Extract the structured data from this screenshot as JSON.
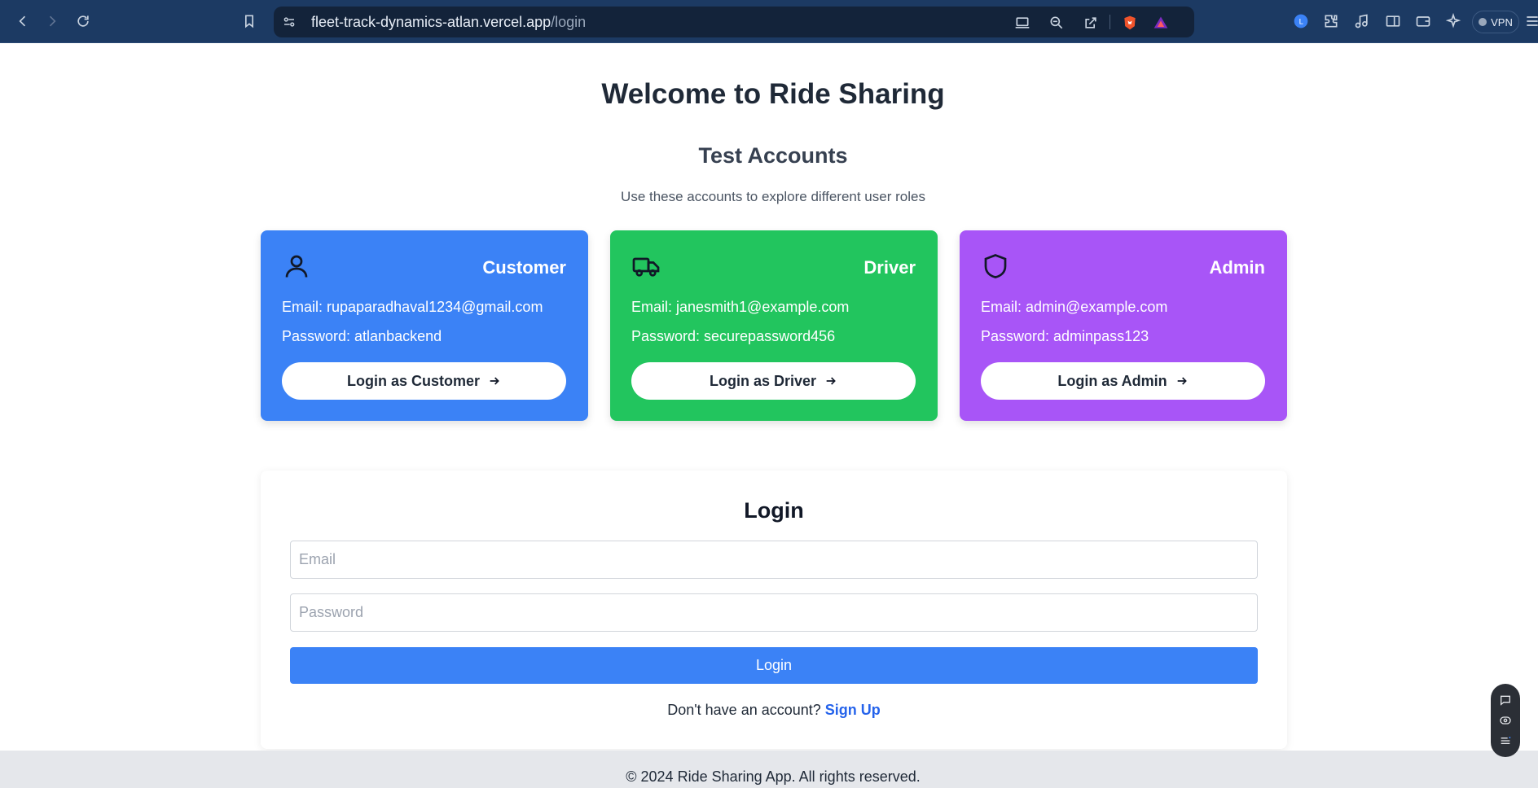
{
  "browser": {
    "url_host": "fleet-track-dynamics-atlan.vercel.app",
    "url_path": "/login",
    "vpn_label": "VPN",
    "colors": {
      "chrome_bg": "#1c3a63",
      "urlbar_bg": "#13233a"
    }
  },
  "page": {
    "title": "Welcome to Ride Sharing",
    "test_accounts_title": "Test Accounts",
    "test_accounts_subtitle": "Use these accounts to explore different user roles"
  },
  "accounts": [
    {
      "role": "Customer",
      "icon": "user-icon",
      "color": "#3b82f6",
      "email_line": "Email: rupaparadhaval1234@gmail.com",
      "password_line": "Password: atlanbackend",
      "button_label": "Login as Customer"
    },
    {
      "role": "Driver",
      "icon": "truck-icon",
      "color": "#22c55e",
      "email_line": "Email: janesmith1@example.com",
      "password_line": "Password: securepassword456",
      "button_label": "Login as Driver"
    },
    {
      "role": "Admin",
      "icon": "shield-icon",
      "color": "#a855f7",
      "email_line": "Email: admin@example.com",
      "password_line": "Password: adminpass123",
      "button_label": "Login as Admin"
    }
  ],
  "login_form": {
    "title": "Login",
    "email_placeholder": "Email",
    "password_placeholder": "Password",
    "submit_label": "Login",
    "signup_prompt": "Don't have an account?",
    "signup_link": "Sign Up",
    "accent": "#3b82f6"
  },
  "footer": {
    "copyright": "© 2024 Ride Sharing App. All rights reserved."
  }
}
